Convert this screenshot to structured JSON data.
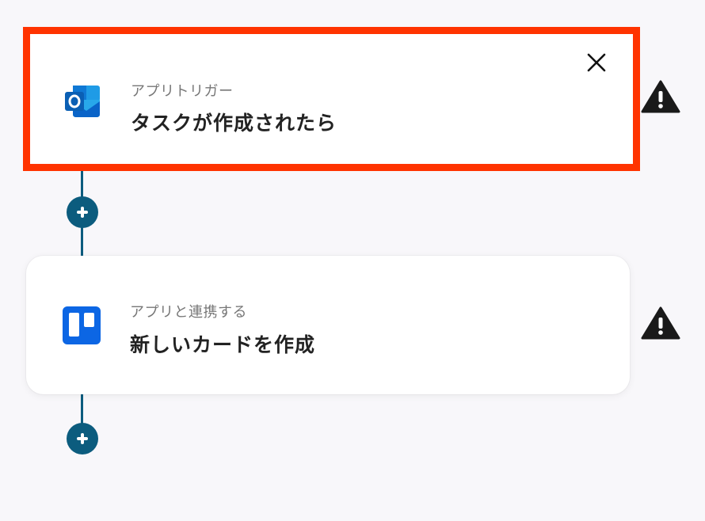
{
  "flow": {
    "steps": [
      {
        "type_label": "アプリトリガー",
        "title": "タスクが作成されたら",
        "app_icon": "outlook-icon",
        "selected": true,
        "status_icon": "warning-icon"
      },
      {
        "type_label": "アプリと連携する",
        "title": "新しいカードを作成",
        "app_icon": "trello-icon",
        "selected": false,
        "status_icon": "warning-icon"
      }
    ],
    "add_step_icon": "plus-icon",
    "close_icon": "close-icon",
    "colors": {
      "connector": "#0c5c7e",
      "selected_border": "#ff3300",
      "background": "#f8f7fa",
      "outlook_blue": "#0a64c8",
      "trello_blue": "#0c66e4"
    }
  }
}
